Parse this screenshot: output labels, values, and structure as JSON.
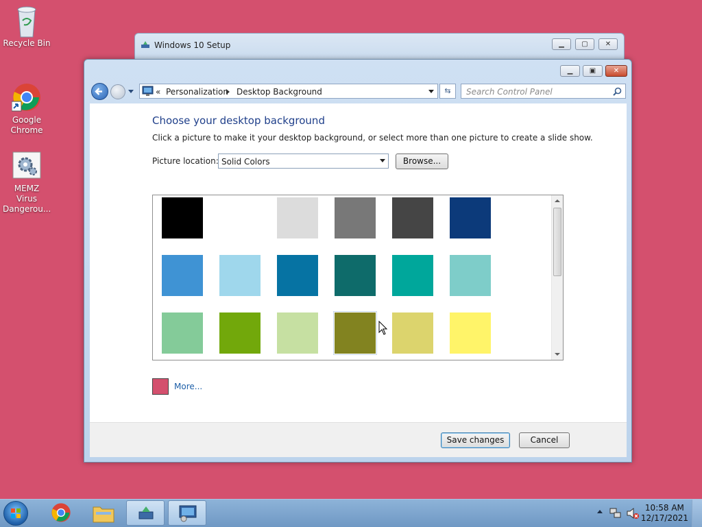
{
  "desktop": {
    "icons": [
      {
        "label": "Recycle Bin"
      },
      {
        "label": "Google Chrome"
      },
      {
        "label": "MEMZ Virus Dangerou..."
      }
    ]
  },
  "background_window": {
    "title": "Windows 10 Setup"
  },
  "window": {
    "address": {
      "chevrons": "«",
      "crumb1": "Personalization",
      "crumb2": "Desktop Background"
    },
    "search_placeholder": "Search Control Panel",
    "heading": "Choose your desktop background",
    "subtitle": "Click a picture to make it your desktop background, or select more than one picture to create a slide show.",
    "picture_location_label": "Picture location:",
    "picture_location_value": "Solid Colors",
    "browse_label": "Browse...",
    "swatches": [
      "#000000",
      "#ffffff",
      "#dcdcdc",
      "#787878",
      "#454545",
      "#0c3a7a",
      "#3f93d4",
      "#9fd7ec",
      "#0673a3",
      "#0e6b6a",
      "#00a79b",
      "#7ecdc9",
      "#84cb99",
      "#72a80b",
      "#c6e0a2",
      "#828320",
      "#dcd46d",
      "#fff469"
    ],
    "hovered_swatch_index": 15,
    "more_label": "More...",
    "more_color": "#d4506e",
    "save_label": "Save changes",
    "cancel_label": "Cancel"
  },
  "taskbar": {
    "time": "10:58 AM",
    "date": "12/17/2021"
  }
}
